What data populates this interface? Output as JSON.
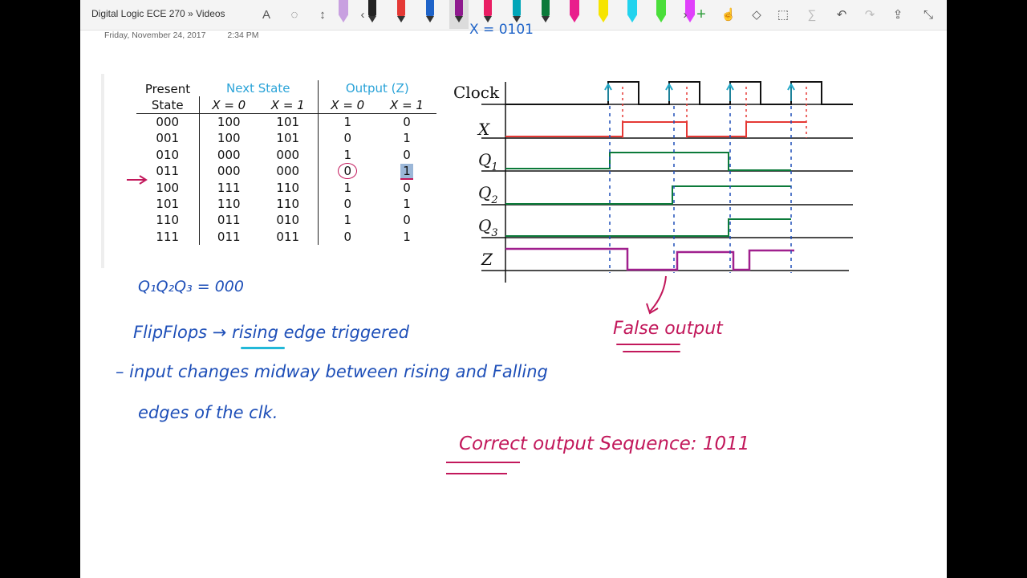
{
  "app": {
    "breadcrumb": "Digital Logic ECE 270 » Videos"
  },
  "note_meta": {
    "date": "Friday, November 24, 2017",
    "time": "2:34 PM"
  },
  "toolbar": {
    "left_tools": [
      {
        "name": "type-text-icon",
        "glyph": "A"
      },
      {
        "name": "lasso-select-icon",
        "glyph": "◌"
      },
      {
        "name": "insert-space-icon",
        "glyph": "↕"
      }
    ],
    "pens": [
      {
        "color": "#c8a0e0",
        "kind": "highlighter"
      },
      {
        "color": "#222222",
        "kind": "pen"
      },
      {
        "color": "#e53935",
        "kind": "pen"
      },
      {
        "color": "#1e63c8",
        "kind": "pen"
      },
      {
        "color": "#8e1a8e",
        "kind": "pen",
        "selected": true
      },
      {
        "color": "#e91e63",
        "kind": "pen"
      },
      {
        "color": "#00a5b8",
        "kind": "pen"
      },
      {
        "color": "#0c7a3a",
        "kind": "pen"
      },
      {
        "color": "#e91e8c",
        "kind": "highlighter"
      },
      {
        "color": "#f6e400",
        "kind": "highlighter"
      },
      {
        "color": "#22d3ee",
        "kind": "highlighter"
      },
      {
        "color": "#4ade3a",
        "kind": "highlighter"
      },
      {
        "color": "#e040fb",
        "kind": "highlighter"
      }
    ],
    "right_tools": [
      {
        "name": "add-pen-icon",
        "glyph": "+"
      },
      {
        "name": "touch-draw-icon",
        "glyph": "☝"
      },
      {
        "name": "shapes-icon",
        "glyph": "◇"
      },
      {
        "name": "ink-to-shape-icon",
        "glyph": "⬚"
      },
      {
        "name": "ink-to-math-icon",
        "glyph": "∑"
      },
      {
        "name": "undo-icon",
        "glyph": "↶"
      },
      {
        "name": "redo-icon",
        "glyph": "↷"
      },
      {
        "name": "share-icon",
        "glyph": "⇪"
      },
      {
        "name": "collapse-icon",
        "glyph": "⤡"
      }
    ]
  },
  "state_table": {
    "header": {
      "present1": "Present",
      "present2": "State",
      "next_state": "Next State",
      "output": "Output (Z)",
      "x0": "X = 0",
      "x1": "X = 1",
      "ox0": "X = 0",
      "ox1": "X = 1"
    },
    "rows": [
      {
        "present": "000",
        "n0": "100",
        "n1": "101",
        "z0": "1",
        "z1": "0"
      },
      {
        "present": "001",
        "n0": "100",
        "n1": "101",
        "z0": "0",
        "z1": "1"
      },
      {
        "present": "010",
        "n0": "000",
        "n1": "000",
        "z0": "1",
        "z1": "0"
      },
      {
        "present": "011",
        "n0": "000",
        "n1": "000",
        "z0": "0",
        "z1": "1"
      },
      {
        "present": "100",
        "n0": "111",
        "n1": "110",
        "z0": "1",
        "z1": "0"
      },
      {
        "present": "101",
        "n0": "110",
        "n1": "110",
        "z0": "0",
        "z1": "1"
      },
      {
        "present": "110",
        "n0": "011",
        "n1": "010",
        "z0": "1",
        "z1": "0"
      },
      {
        "present": "111",
        "n0": "011",
        "n1": "011",
        "z0": "0",
        "z1": "1"
      }
    ]
  },
  "timing": {
    "labels": {
      "clock": "Clock",
      "x": "X",
      "q1": "Q",
      "q1s": "1",
      "q2": "Q",
      "q2s": "2",
      "q3": "Q",
      "q3s": "3",
      "z": "Z"
    },
    "top_note": "X = 0101"
  },
  "notes": {
    "init_state": "Q₁Q₂Q₃ = 000",
    "flipflops": "FlipFlops → rising edge triggered",
    "line1": "– input changes midway between rising and Falling",
    "line2": "edges of the clk.",
    "false_output": "False output",
    "correct_output": "Correct output Sequence: 1011"
  }
}
